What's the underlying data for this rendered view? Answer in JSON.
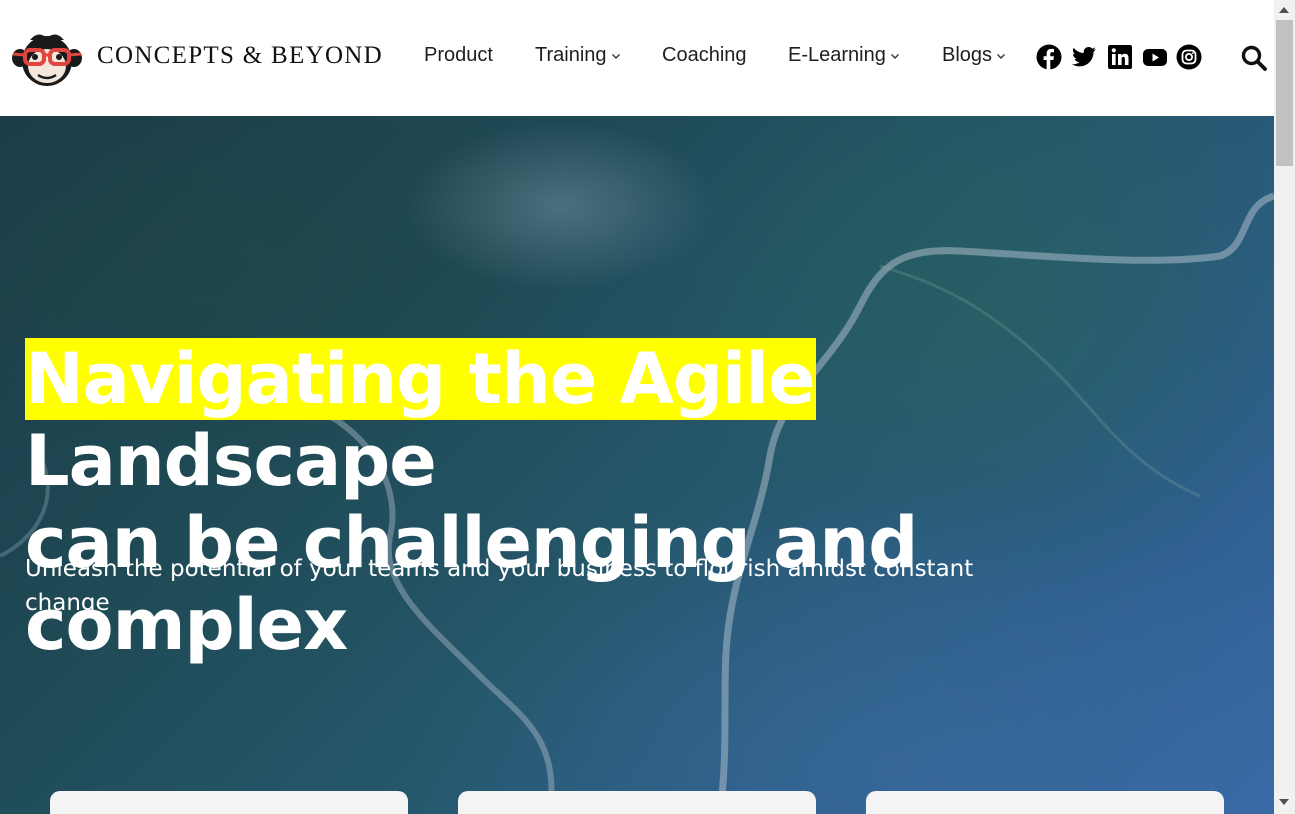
{
  "brand": {
    "name": "CONCEPTS & BEYOND"
  },
  "nav": {
    "items": [
      {
        "label": "Product",
        "has_dropdown": false
      },
      {
        "label": "Training",
        "has_dropdown": true
      },
      {
        "label": "Coaching",
        "has_dropdown": false
      },
      {
        "label": "E-Learning",
        "has_dropdown": true
      },
      {
        "label": "Blogs",
        "has_dropdown": true
      }
    ],
    "social_icons": [
      "facebook-icon",
      "twitter-icon",
      "linkedin-icon",
      "youtube-icon",
      "instagram-icon"
    ],
    "search_icon": "search-icon"
  },
  "hero": {
    "title_highlight": "Navigating the Agile",
    "title_rest_line1": " Landscape",
    "title_line2": "can be challenging and complex",
    "subtitle": "Unleash the potential of your teams and your business to flourish amidst constant change",
    "highlight_color": "#ffff00"
  },
  "colors": {
    "text_dark": "#1f1f1f",
    "hero_text": "#ffffff"
  }
}
